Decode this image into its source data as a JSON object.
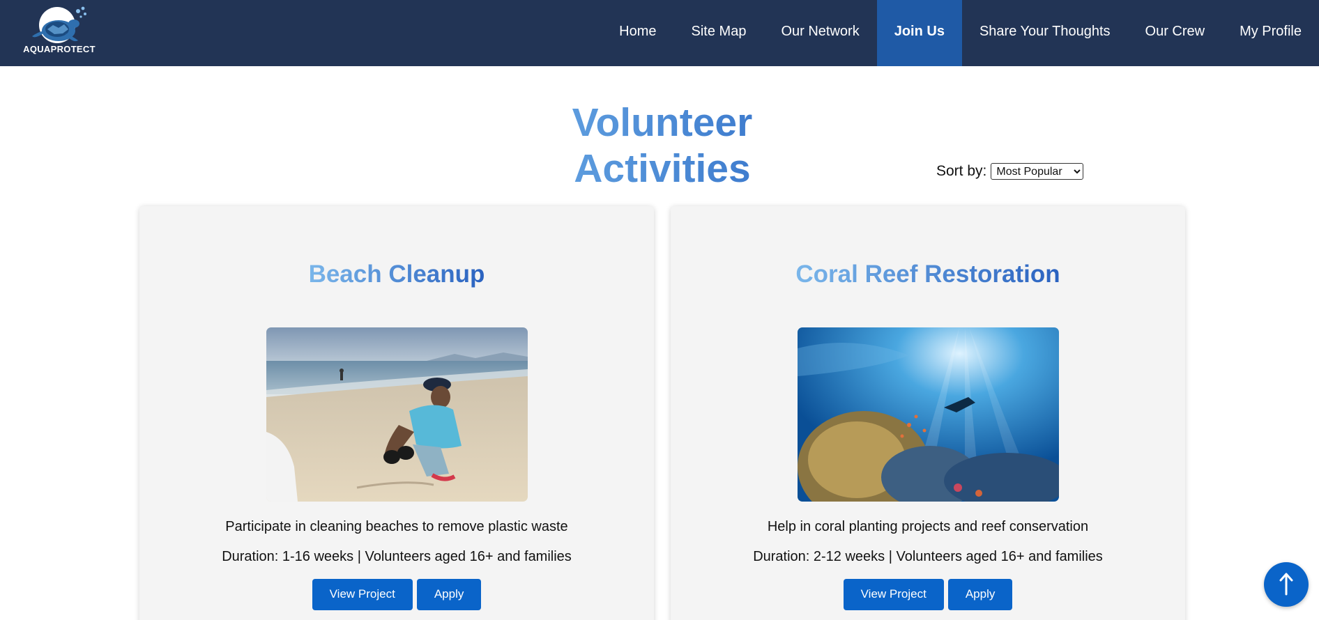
{
  "header": {
    "logo_text": "AQUAPROTECT",
    "logo_icon": "sea-turtle-logo",
    "nav": [
      {
        "label": "Home",
        "active": false
      },
      {
        "label": "Site Map",
        "active": false
      },
      {
        "label": "Our Network",
        "active": false
      },
      {
        "label": "Join Us",
        "active": true
      },
      {
        "label": "Share Your Thoughts",
        "active": false
      },
      {
        "label": "Our Crew",
        "active": false
      },
      {
        "label": "My Profile",
        "active": false
      }
    ]
  },
  "main": {
    "title": "Volunteer Activities",
    "sort": {
      "label": "Sort by:",
      "selected": "Most Popular"
    },
    "cards": [
      {
        "title": "Beach Cleanup",
        "image": "beach-cleanup-photo",
        "description": "Participate in cleaning beaches to remove plastic waste",
        "meta": "Duration: 1-16 weeks | Volunteers aged 16+ and families",
        "view_label": "View Project",
        "apply_label": "Apply"
      },
      {
        "title": "Coral Reef Restoration",
        "image": "coral-reef-photo",
        "description": "Help in coral planting projects and reef conservation",
        "meta": "Duration: 2-12 weeks | Volunteers aged 16+ and families",
        "view_label": "View Project",
        "apply_label": "Apply"
      }
    ]
  },
  "back_to_top": {
    "icon": "arrow-up-icon"
  },
  "colors": {
    "header_bg": "#223455",
    "active_nav_bg": "#1f5aa6",
    "button_bg": "#0a64c9",
    "card_bg": "#f4f4f4"
  }
}
